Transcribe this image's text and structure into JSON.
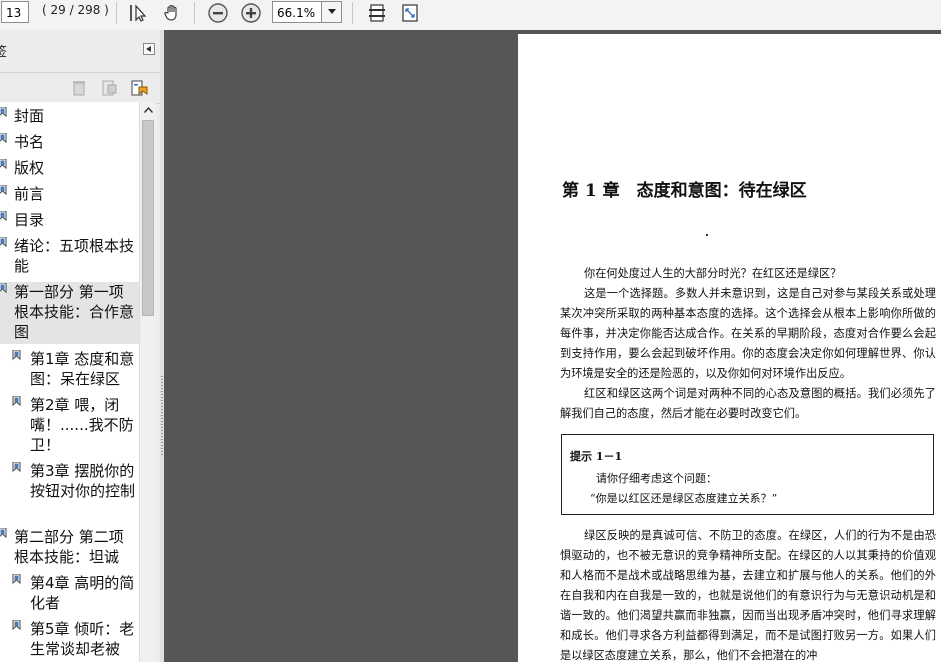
{
  "toolbar": {
    "page_number": "13",
    "page_count": "( 29 / 298 )",
    "zoom": "66.1%",
    "icons": [
      "select-tool-icon",
      "hand-tool-icon",
      "zoom-out-icon",
      "zoom-in-icon",
      "fit-page-icon",
      "fit-width-icon"
    ]
  },
  "panel": {
    "title": "签",
    "tool_icons": [
      "delete-bookmark-icon",
      "new-bookmark-icon",
      "bookmark-options-icon"
    ],
    "bookmarks": [
      {
        "label": "封面"
      },
      {
        "label": "书名"
      },
      {
        "label": "版权"
      },
      {
        "label": "前言"
      },
      {
        "label": "目录"
      },
      {
        "label": "绪论：五项根本技能"
      },
      {
        "label": "第一部分 第一项根本技能：合作意图"
      },
      {
        "label": "第1章 态度和意图：呆在绿区"
      },
      {
        "label": "第2章 喂，闭嘴！......我不防卫！"
      },
      {
        "label": "第3章 摆脱你的按钮对你的控制"
      },
      {
        "label": "第二部分 第二项根本技能：坦诚"
      },
      {
        "label": "第4章 高明的简化者"
      },
      {
        "label": "第5章 倾听：老生常谈却老被"
      }
    ]
  },
  "document": {
    "chapter_title": "第 1 章　态度和意图：待在绿区",
    "paragraphs": [
      "你在何处度过人生的大部分时光？在红区还是绿区？",
      "这是一个选择题。多数人并未意识到，这是自己对参与某段关系或处理某次冲突所采取的两种基本态度的选择。这个选择会从根本上影响你所做的每件事，并决定你能否达成合作。在关系的早期阶段，态度对合作要么会起到支持作用，要么会起到破坏作用。你的态度会决定你如何理解世界、你认为环境是安全的还是险恶的，以及你如何对环境作出反应。",
      "红区和绿区这两个词是对两种不同的心态及意图的概括。我们必须先了解我们自己的态度，然后才能在必要时改变它们。"
    ],
    "tip": {
      "title": "提示 1－1",
      "line1": "请你仔细考虑这个问题：",
      "line2": "“你是以红区还是绿区态度建立关系？”"
    },
    "paragraph_after": "绿区反映的是真诚可信、不防卫的态度。在绿区，人们的行为不是由恐惧驱动的，也不被无意识的竞争精神所支配。在绿区的人以其秉持的价值观和人格而不是战术或战略思维为基，去建立和扩展与他人的关系。他们的外在自我和内在自我是一致的，也就是说他们的有意识行为与无意识动机是和谐一致的。他们渴望共赢而非独赢，因而当出现矛盾冲突时，他们寻求理解和成长。他们寻求各方利益都得到满足，而不是试图打败另一方。如果人们是以绿区态度建立关系，那么，他们不会把潜在的冲"
  }
}
